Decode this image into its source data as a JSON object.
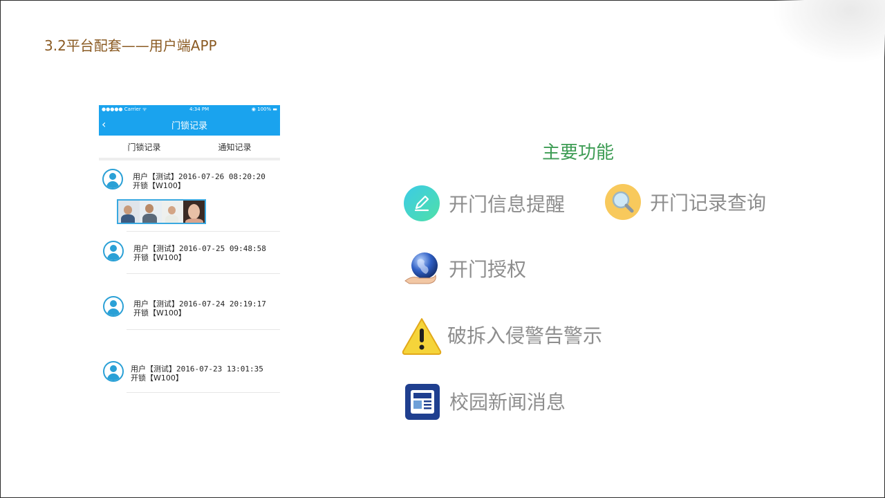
{
  "slide": {
    "title": "3.2平台配套——用户端APP"
  },
  "phone": {
    "status": {
      "carrier": "●●●●● Carrier  ᯤ",
      "time": "4:34 PM",
      "battery": "◉  100% ▬"
    },
    "nav": {
      "back": "‹",
      "title": "门锁记录"
    },
    "tabs": [
      "门锁记录",
      "通知记录"
    ],
    "records": [
      {
        "line1": "用户【测试】2016-07-26 08:20:20",
        "line2": "开锁【W100】"
      },
      {
        "line1": "用户【测试】2016-07-25 09:48:58",
        "line2": "开锁【W100】"
      },
      {
        "line1": "用户【测试】2016-07-24 20:19:17",
        "line2": "开锁【W100】"
      },
      {
        "line1": "用户【测试】2016-07-23 13:01:35",
        "line2": "开锁【W100】"
      }
    ]
  },
  "features": {
    "title": "主要功能",
    "items": [
      {
        "label": "开门信息提醒",
        "icon": "edit-icon"
      },
      {
        "label": "开门记录查询",
        "icon": "search-icon"
      },
      {
        "label": "开门授权",
        "icon": "globe-hand-icon"
      },
      {
        "label": "破拆入侵警告警示",
        "icon": "warning-icon"
      },
      {
        "label": "校园新闻消息",
        "icon": "news-icon"
      }
    ]
  },
  "colors": {
    "title": "#8a5a22",
    "feature_title": "#3d9c54",
    "feature_text": "#8d8d8d",
    "app_blue": "#1aa3ee"
  }
}
